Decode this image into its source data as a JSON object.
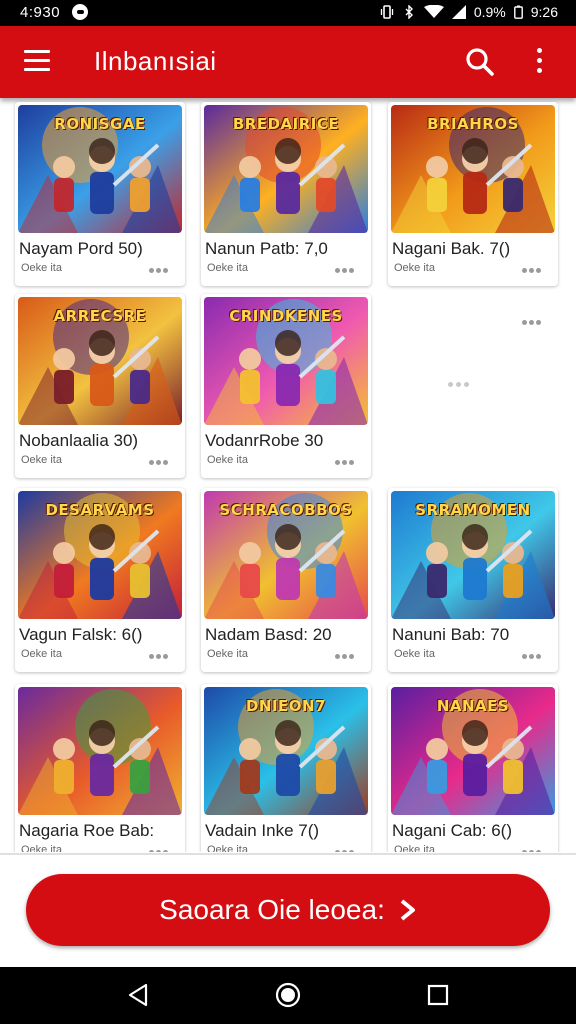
{
  "status_bar": {
    "time": "4:930",
    "battery": "0.9%",
    "clock": "9:26"
  },
  "app_bar": {
    "title": "Ilnbanısiai"
  },
  "colors": {
    "primary": "#d40d12",
    "divider": "#e0e0e0"
  },
  "games": [
    {
      "title": "Nayam Pord 50)",
      "subtitle": "Oeke ita",
      "banner": "RONISGAE"
    },
    {
      "title": "Nanun Patb: 7,0",
      "subtitle": "Oeke ita",
      "banner": "BREDAIRICE"
    },
    {
      "title": "Nagani Bak. 7()",
      "subtitle": "Oeke ita",
      "banner": "BRIAHROS"
    },
    {
      "title": "Nobanlaalia 30)",
      "subtitle": "Oeke ita",
      "banner": "ARRECSRE"
    },
    {
      "title": "VodanrRobe 30",
      "subtitle": "Oeke ita",
      "banner": "CRINDKENES"
    },
    {
      "title": "",
      "subtitle": "",
      "banner": ""
    },
    {
      "title": "Vagun Falsk: 6()",
      "subtitle": "Oeke ita",
      "banner": "DESARVAMS"
    },
    {
      "title": "Nadam Basd: 20",
      "subtitle": "Oeke ita",
      "banner": "SCHRACOBBOS"
    },
    {
      "title": "Nanuni Bab: 70",
      "subtitle": "Oeke ita",
      "banner": "SRRAMOMEN"
    },
    {
      "title": "Nagaria Roe Bab:",
      "subtitle": "Oeke ita",
      "banner": ""
    },
    {
      "title": "Vadain Inke 7()",
      "subtitle": "Oeke ita",
      "banner": "DNIEON7"
    },
    {
      "title": "Nagani Cab: 6()",
      "subtitle": "Oeke ita",
      "banner": "NANAES"
    }
  ],
  "cta": {
    "label": "Saoara Oie leoea:"
  }
}
